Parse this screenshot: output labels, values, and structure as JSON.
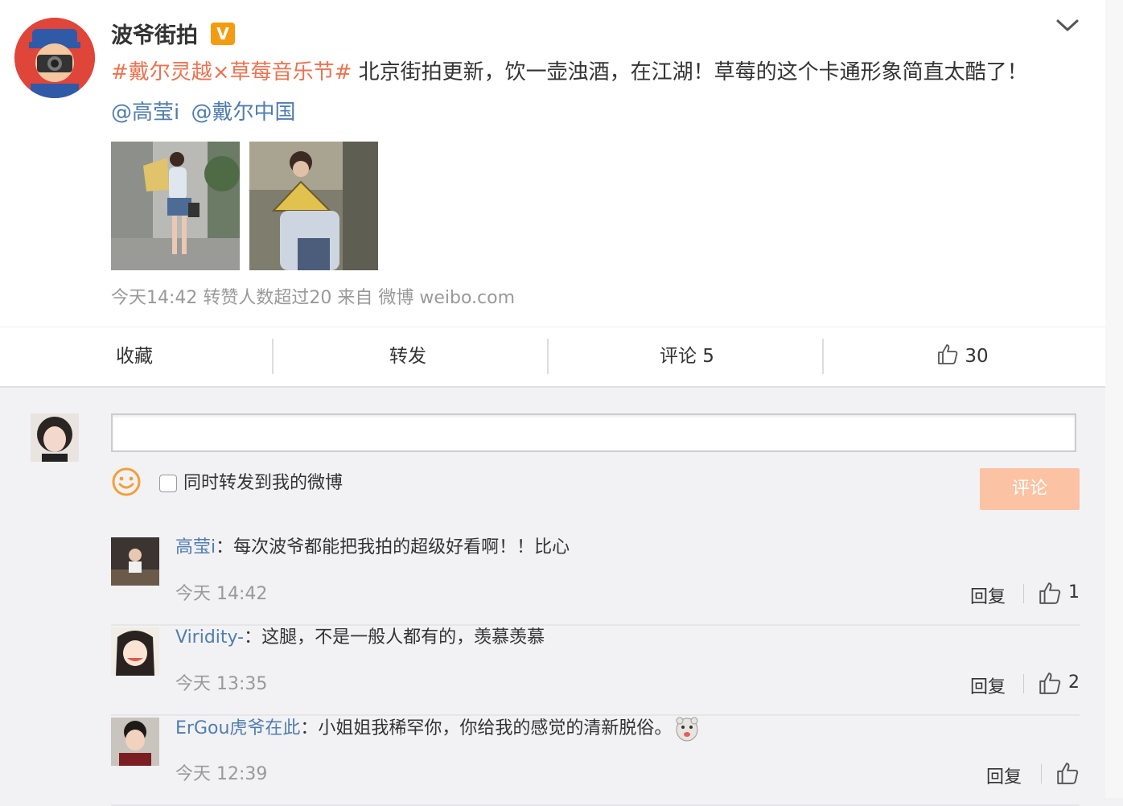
{
  "post": {
    "user_name": "波爷街拍",
    "verified_badge": "V",
    "topic": "#戴尔灵越×草莓音乐节#",
    "text": " 北京街拍更新，饮一壶浊酒，在江湖！草莓的这个卡通形象简直太酷了！",
    "mentions": [
      "@高莹i",
      "@戴尔中国"
    ],
    "meta": "今天14:42 转赞人数超过20 来自 微博 weibo.com"
  },
  "actions": {
    "favorite": "收藏",
    "repost": "转发",
    "comment": "评论 5",
    "like_count": "30"
  },
  "composer": {
    "input_value": "",
    "repost_label": "同时转发到我的微博",
    "submit_label": "评论"
  },
  "comments": [
    {
      "user": "高莹i",
      "sep": "：",
      "text": "每次波爷都能把我拍的超级好看啊！！比心",
      "time": "今天 14:42",
      "reply": "回复",
      "likes": "1"
    },
    {
      "user": "Viridity-",
      "sep": "：",
      "text": "这腿，不是一般人都有的，羡慕羡慕",
      "time": "今天 13:35",
      "reply": "回复",
      "likes": "2"
    },
    {
      "user": "ErGou虎爷在此",
      "sep": "：",
      "text": "小姐姐我稀罕你，你给我的感觉的清新脱俗。",
      "time": "今天 12:39",
      "reply": "回复",
      "likes": ""
    }
  ],
  "colors": {
    "topic": "#eb7350",
    "link": "#507daf",
    "badge": "#f39c12",
    "submit_disabled": "#fbc3a3",
    "meta": "#999999"
  },
  "icons": [
    "chevron-down-icon",
    "thumbs-up-icon",
    "smiley-icon",
    "emoji-sticker-icon"
  ]
}
